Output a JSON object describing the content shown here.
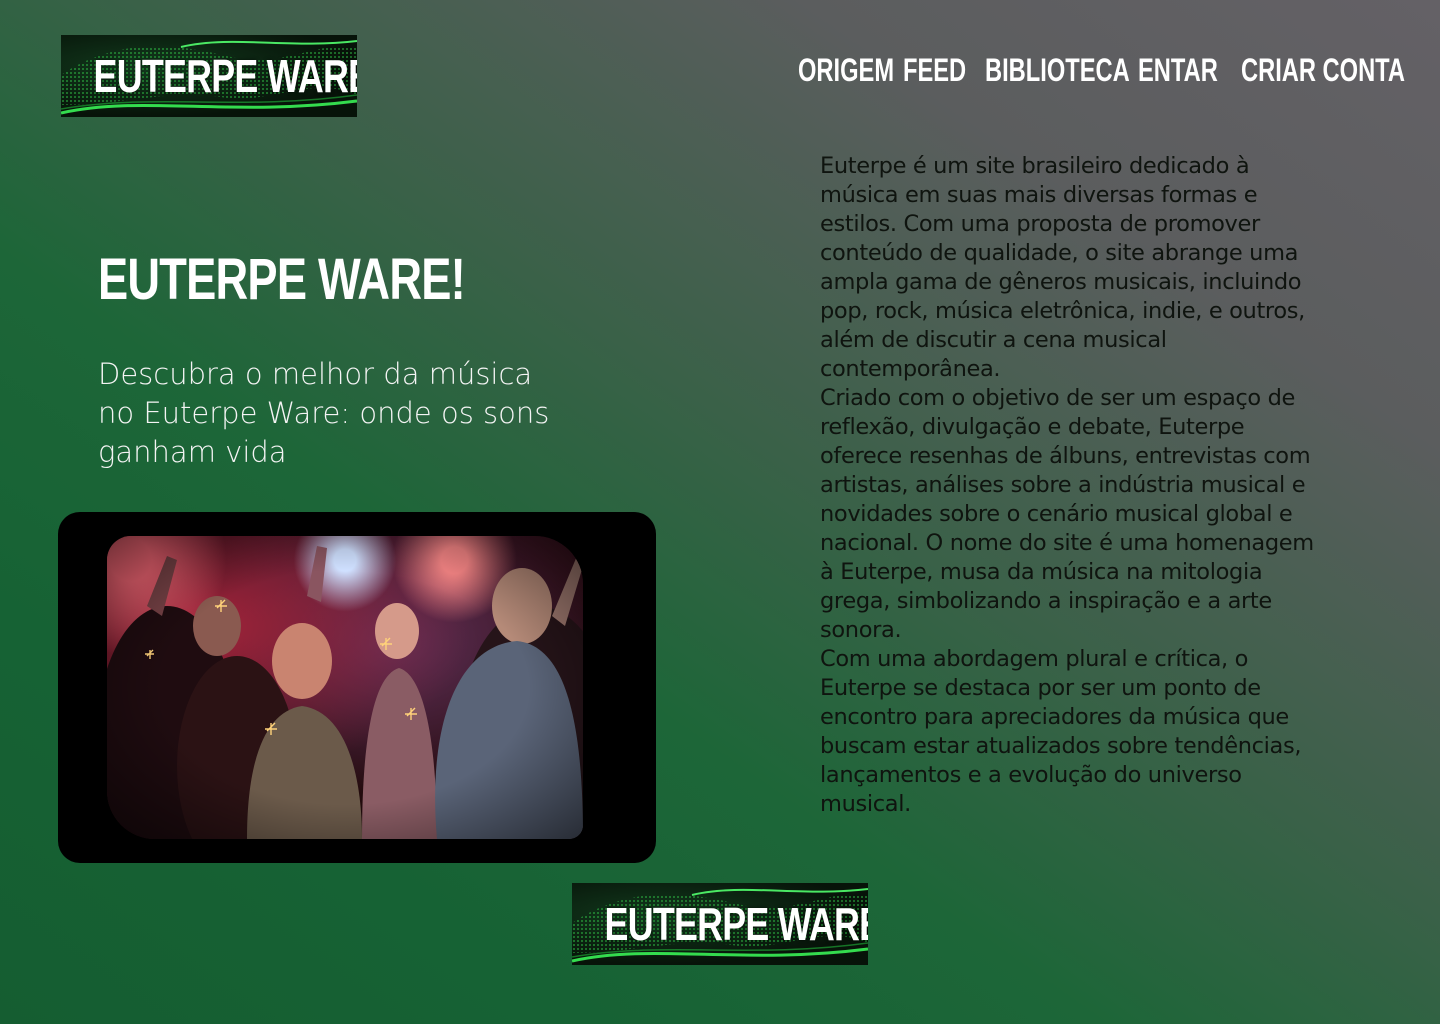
{
  "brand": {
    "logo_text": "EUTERPE WARE"
  },
  "nav": {
    "items": [
      {
        "label": "ORIGEM"
      },
      {
        "label": "FEED"
      },
      {
        "label": "BIBLIOTECA"
      },
      {
        "label": "ENTAR"
      },
      {
        "label": "CRIAR CONTA"
      }
    ]
  },
  "hero": {
    "title": "EUTERPE WARE!",
    "subtitle": "Descubra o melhor da música no Euterpe Ware: onde os sons ganham vida"
  },
  "about": {
    "paragraphs": [
      "Euterpe é um site brasileiro dedicado à música em suas mais diversas formas e estilos. Com uma proposta de promover conteúdo de qualidade, o site abrange uma ampla gama de gêneros musicais, incluindo pop, rock, música eletrônica, indie, e outros, além de discutir a cena musical contemporânea.",
      "Criado com o objetivo de ser um espaço de reflexão, divulgação e debate, Euterpe oferece resenhas de álbuns, entrevistas com artistas, análises sobre a indústria musical e novidades sobre o cenário musical global e nacional. O nome do site é uma homenagem à Euterpe, musa da música na mitologia grega, simbolizando a inspiração e a arte sonora.",
      "Com uma abordagem plural e crítica, o Euterpe se destaca por ser um ponto de encontro para apreciadores da música que buscam estar atualizados sobre tendências, lançamentos e a evolução do universo musical."
    ]
  },
  "footer": {
    "logo_text": "EUTERPE WARE"
  },
  "colors": {
    "green_dark": "#155d31",
    "gray": "#646166",
    "wave_green": "#3cff5a"
  },
  "icons": {
    "logo_wave": "green-particle-wave-icon"
  }
}
